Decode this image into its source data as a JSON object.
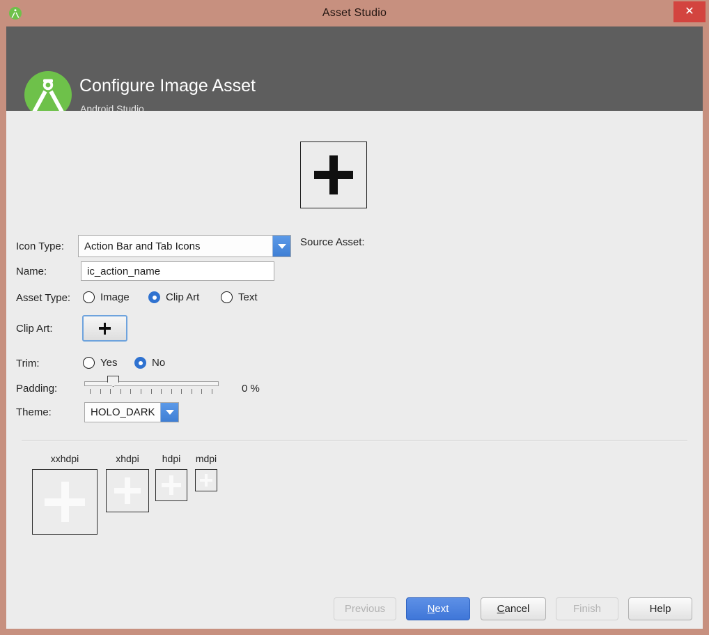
{
  "window": {
    "title": "Asset Studio",
    "icon": "android-studio-icon",
    "close_label": "✕"
  },
  "header": {
    "title": "Configure Image Asset",
    "subtitle": "Android Studio",
    "logo": "android-studio-logo"
  },
  "form": {
    "icon_type": {
      "label": "Icon Type:",
      "value": "Action Bar and Tab Icons"
    },
    "name": {
      "label": "Name:",
      "value": "ic_action_name",
      "placeholder": "ic_action_name"
    },
    "asset_type": {
      "label": "Asset Type:",
      "options": [
        {
          "label": "Image",
          "selected": false
        },
        {
          "label": "Clip Art",
          "selected": true
        },
        {
          "label": "Text",
          "selected": false
        }
      ]
    },
    "clip_art": {
      "label": "Clip Art:",
      "button_glyph": "plus-icon"
    },
    "trim": {
      "label": "Trim:",
      "options": [
        {
          "label": "Yes",
          "selected": false
        },
        {
          "label": "No",
          "selected": true
        }
      ]
    },
    "padding": {
      "label": "Padding:",
      "value": "0 %",
      "percent": 0,
      "min": 0,
      "max": 100,
      "ticks": 13
    },
    "theme": {
      "label": "Theme:",
      "value": "HOLO_DARK"
    }
  },
  "source_asset": {
    "label": "Source Asset:",
    "glyph": "plus-icon"
  },
  "previews": {
    "items": [
      {
        "label": "xxhdpi",
        "size": 94
      },
      {
        "label": "xhdpi",
        "size": 64
      },
      {
        "label": "hdpi",
        "size": 48
      },
      {
        "label": "mdpi",
        "size": 32
      }
    ]
  },
  "footer": {
    "buttons": [
      {
        "name": "previous",
        "label": "Previous",
        "mnemonic": "",
        "state": "disabled"
      },
      {
        "name": "next",
        "label": "Next",
        "mnemonic": "N",
        "state": "primary"
      },
      {
        "name": "cancel",
        "label": "Cancel",
        "mnemonic": "C",
        "state": "normal"
      },
      {
        "name": "finish",
        "label": "Finish",
        "mnemonic": "",
        "state": "disabled"
      },
      {
        "name": "help",
        "label": "Help",
        "mnemonic": "",
        "state": "normal"
      }
    ]
  },
  "colors": {
    "titlebar": "#c7907f",
    "header_band": "#5e5e5e",
    "content": "#ececec",
    "accent_blue": "#3f76d8",
    "close_red": "#d3443f",
    "logo_green": "#6ec14a"
  }
}
